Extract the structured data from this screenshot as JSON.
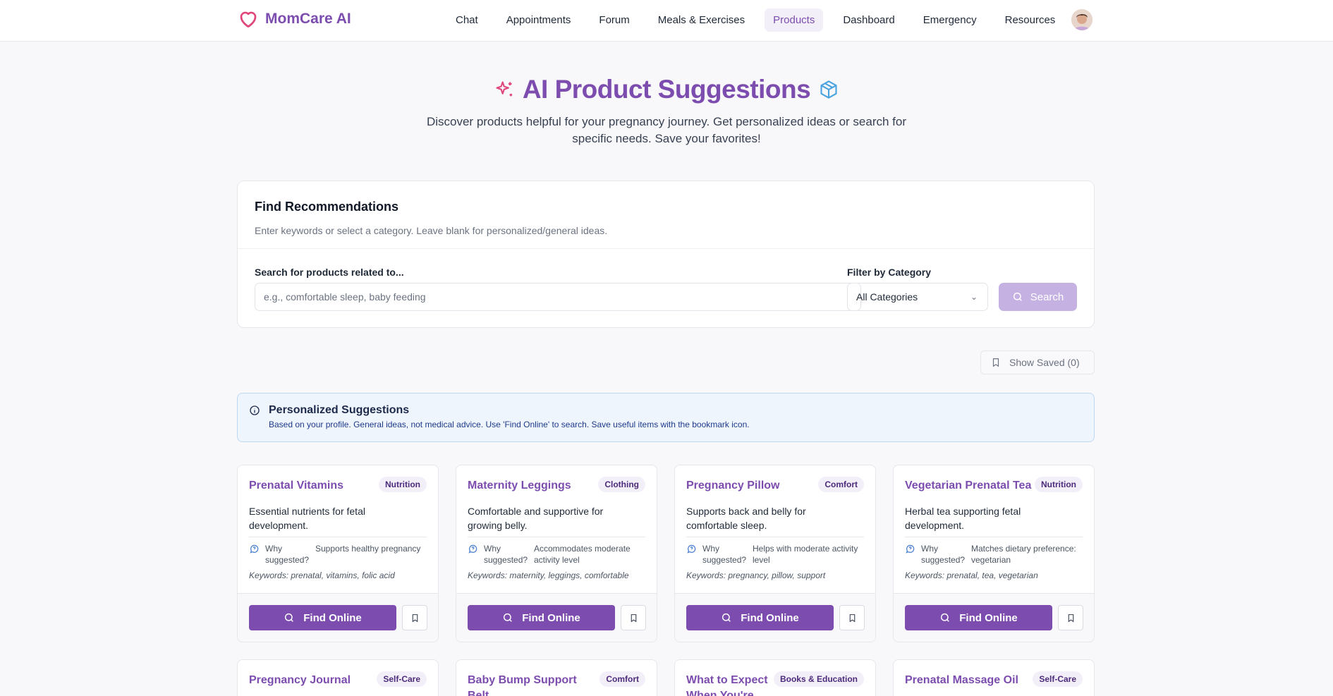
{
  "brand": {
    "name": "MomCare AI"
  },
  "nav": {
    "links": [
      "Chat",
      "Appointments",
      "Forum",
      "Meals & Exercises",
      "Products",
      "Dashboard",
      "Emergency",
      "Resources"
    ],
    "active": "Products"
  },
  "hero": {
    "title": "AI Product Suggestions",
    "subtitle": "Discover products helpful for your pregnancy journey. Get personalized ideas or search for specific needs. Save your favorites!"
  },
  "search_card": {
    "title": "Find Recommendations",
    "description": "Enter keywords or select a category. Leave blank for personalized/general ideas.",
    "search_label": "Search for products related to...",
    "search_placeholder": "e.g., comfortable sleep, baby feeding",
    "category_label": "Filter by Category",
    "category_value": "All Categories",
    "search_button": "Search"
  },
  "saved_button": "Show Saved (0)",
  "info": {
    "title": "Personalized Suggestions",
    "description": "Based on your profile. General ideas, not medical advice. Use 'Find Online' to search. Save useful items with the bookmark icon."
  },
  "products": [
    {
      "title": "Prenatal Vitamins",
      "category": "Nutrition",
      "description": "Essential nutrients for fetal development.",
      "why_label": "Why suggested?",
      "why": "Supports healthy pregnancy",
      "keywords": "Keywords: prenatal, vitamins, folic acid",
      "button": "Find Online"
    },
    {
      "title": "Maternity Leggings",
      "category": "Clothing",
      "description": "Comfortable and supportive for growing belly.",
      "why_label": "Why suggested?",
      "why": "Accommodates moderate activity level",
      "keywords": "Keywords: maternity, leggings, comfortable",
      "button": "Find Online"
    },
    {
      "title": "Pregnancy Pillow",
      "category": "Comfort",
      "description": "Supports back and belly for comfortable sleep.",
      "why_label": "Why suggested?",
      "why": "Helps with moderate activity level",
      "keywords": "Keywords: pregnancy, pillow, support",
      "button": "Find Online"
    },
    {
      "title": "Vegetarian Prenatal Tea",
      "category": "Nutrition",
      "description": "Herbal tea supporting fetal development.",
      "why_label": "Why suggested?",
      "why": "Matches dietary preference: vegetarian",
      "keywords": "Keywords: prenatal, tea, vegetarian",
      "button": "Find Online"
    },
    {
      "title": "Pregnancy Journal",
      "category": "Self-Care"
    },
    {
      "title": "Baby Bump Support Belt",
      "category": "Comfort"
    },
    {
      "title": "What to Expect When You're",
      "category": "Books & Education"
    },
    {
      "title": "Prenatal Massage Oil",
      "category": "Self-Care"
    }
  ],
  "colors": {
    "brand": "#7c4daf",
    "accent_pink": "#e0457b",
    "accent_blue": "#4aa3df"
  }
}
